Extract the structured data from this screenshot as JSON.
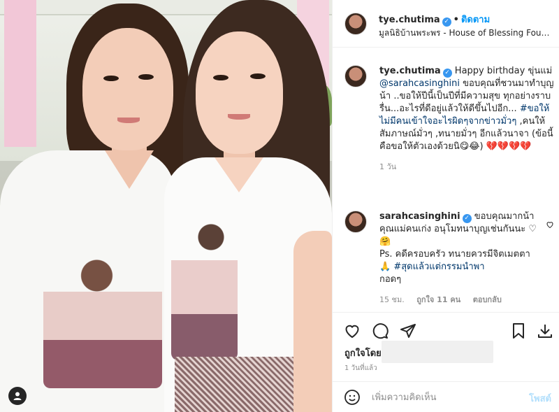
{
  "header": {
    "username": "tye.chutima",
    "follow_label": "ติดตาม",
    "location": "มูลนิธิบ้านพระพร - House of Blessing Foundati..."
  },
  "caption": {
    "username": "tye.chutima",
    "lead": "Happy birthday ขุ่นแม่",
    "mention": "@sarahcasinghini",
    "text1": "ขอบคุณที่ชวนมาทำบุญน้า ..ขอให้ปีนี้เป็นปีที่มีความสุข ทุกอย่างราบรื่น...อะไรที่ดีอยู่แล้วให้ดีขึ้นไปอีก...",
    "hashtag": "#ขอให้ไม่มีคนเข้าใจอะไรผิดๆจากข่าวมั่วๆ",
    "text2": ",คนให้สัมภาษณ์มั่วๆ ,ทนายมั่วๆ อีกแล้วนาจา (ข้อนี้คือขอให้ตัวเองด้วยนิ😋😂) 💔💔💔💔",
    "time": "1 วัน"
  },
  "reply": {
    "username": "sarahcasinghini",
    "text1": "ขอบคุณมากน้า คุณแม่คนเก่ง อนุโมทนาบุญเช่นกันนะ ♡🤗",
    "text2": "Ps. คดีครอบครัว ทนายควรมีจิตเมตตา 🙏",
    "hashtag": "#สุดแล้วแต่กรรมนำพา",
    "text3": "กอดๆ",
    "time": "15 ชม.",
    "likes": "ถูกใจ 11 คน",
    "reply_label": "ตอบกลับ"
  },
  "footer": {
    "liked_by": "ถูกใจโดย",
    "posted_time": "1 วันที่แล้ว",
    "comment_placeholder": "เพิ่มความคิดเห็น",
    "post_label": "โพสต์"
  },
  "colors": {
    "link": "#00376b",
    "follow": "#0095f6",
    "verified": "#3897f0",
    "muted": "#8e8e8e"
  },
  "icons": [
    "heart-icon",
    "comment-icon",
    "share-icon",
    "bookmark-icon",
    "download-icon",
    "emoji-icon",
    "user-tag-icon",
    "verified-icon"
  ]
}
